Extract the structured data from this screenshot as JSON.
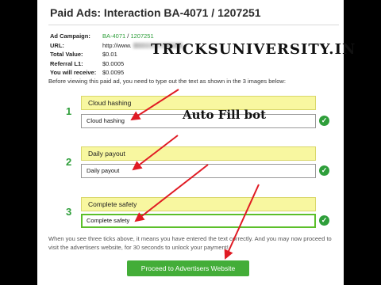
{
  "header": {
    "title": "Paid Ads: Interaction BA-4071 / 1207251"
  },
  "info": {
    "campaign_label": "Ad Campaign:",
    "campaign_link_1": "BA-4071",
    "campaign_sep": " / ",
    "campaign_link_2": "1207251",
    "url_label": "URL:",
    "url_value": "http://www.",
    "total_label": "Total Value:",
    "total_value": "$0.01",
    "referral_label": "Referral L1:",
    "referral_value": "$0.0005",
    "receive_label": "You will receive:",
    "receive_value": "$0.0095"
  },
  "watermark": "TRICKSUNIVERSITY.IN",
  "instructions": "Before viewing this paid ad, you need to type out the text as shown in the 3 images below:",
  "captchas": [
    {
      "number": "1",
      "image_text": "Cloud hashing",
      "input_value": "Cloud hashing"
    },
    {
      "number": "2",
      "image_text": "Daily payout",
      "input_value": "Daily payout"
    },
    {
      "number": "3",
      "image_text": "Complete safety",
      "input_value": "Complete safety"
    }
  ],
  "annotation": "Auto Fill bot",
  "footer_text": "When you see three ticks above, it means you have entered the text correctly. And you may now proceed to visit the advertisers website, for 30 seconds to unlock your payment!",
  "visit_button": "Proceed to Advertisers Website",
  "colors": {
    "accent_green": "#2e9e3a",
    "captcha_yellow": "#f8f7a0",
    "arrow_red": "#e01b24"
  }
}
